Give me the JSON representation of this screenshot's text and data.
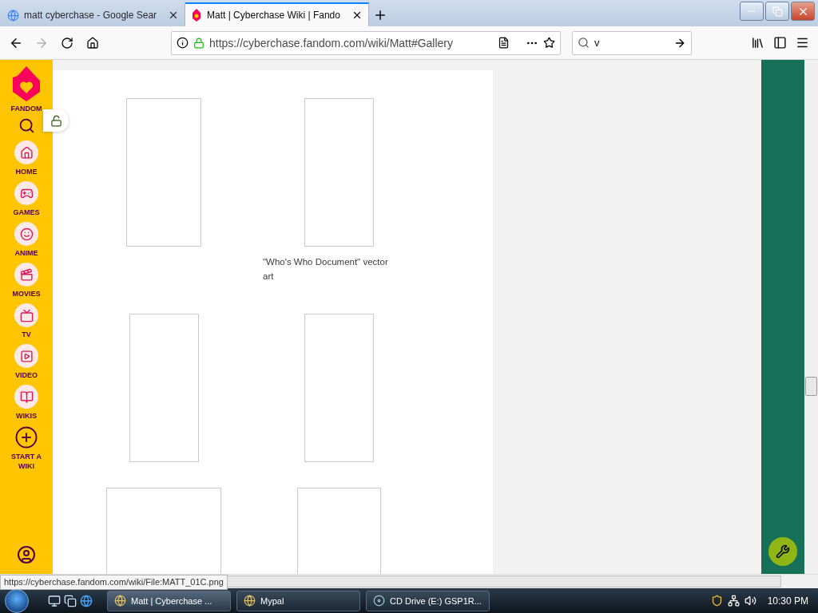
{
  "browser": {
    "tabs": [
      {
        "title": "matt cyberchase - Google Sear",
        "selected": false,
        "kind": "google"
      },
      {
        "title": "Matt | Cyberchase Wiki | Fando",
        "selected": true,
        "kind": "fandom"
      }
    ],
    "nav": {
      "back_disabled": false,
      "forward_disabled": true,
      "url": "https://cyberchase.fandom.com/wiki/Matt#Gallery",
      "search_value": "v"
    },
    "status_url": "https://cyberchase.fandom.com/wiki/File:MATT_01C.png"
  },
  "sidebar": {
    "brand": "FANDOM",
    "items": [
      {
        "label": "HOME",
        "kind": "home"
      },
      {
        "label": "GAMES",
        "kind": "games"
      },
      {
        "label": "ANIME",
        "kind": "anime"
      },
      {
        "label": "MOVIES",
        "kind": "movies"
      },
      {
        "label": "TV",
        "kind": "tv"
      },
      {
        "label": "VIDEO",
        "kind": "video"
      },
      {
        "label": "WIKIS",
        "kind": "wikis"
      },
      {
        "label": "START A WIKI",
        "kind": "start"
      }
    ]
  },
  "gallery_items": [
    {
      "kind": "image"
    },
    {
      "kind": "image",
      "caption": "\"Who's Who Document\" vector art"
    },
    {
      "kind": "image"
    },
    {
      "kind": "image"
    },
    {
      "kind": "image"
    },
    {
      "kind": "image"
    }
  ],
  "taskbar": {
    "tasks": [
      {
        "label": "Matt | Cyberchase ...",
        "selected": true,
        "kind": "browser"
      },
      {
        "label": "Mypal",
        "selected": false,
        "kind": "browser"
      },
      {
        "label": "CD Drive (E:) GSP1R...",
        "selected": false,
        "kind": "drive"
      }
    ],
    "clock": "10:30 PM"
  }
}
